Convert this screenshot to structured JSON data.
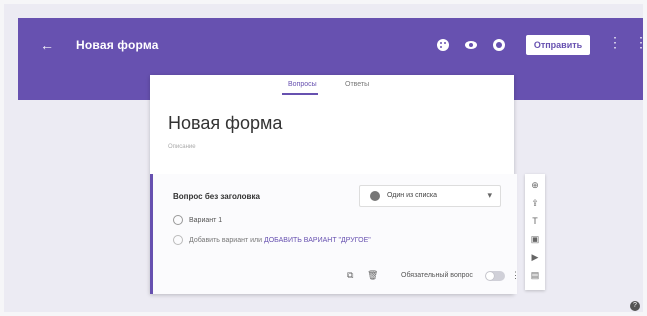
{
  "header": {
    "back_symbol": "←",
    "title": "Новая форма",
    "send_button": "Отправить",
    "kebab": "⋮",
    "more": "⋮"
  },
  "tabs": {
    "questions": "Вопросы",
    "answers": "Ответы"
  },
  "form": {
    "title": "Новая форма",
    "description": "Описание"
  },
  "question": {
    "title": "Вопрос без заголовка",
    "type_label": "Один из списка",
    "option1": "Вариант 1",
    "option2_prefix": "Добавить вариант",
    "option2_or": "или",
    "option2_link": "ДОБАВИТЬ ВАРИАНТ \"ДРУГОЕ\"",
    "required_label": "Обязательный вопрос"
  },
  "colors": {
    "accent": "#6751b0",
    "background": "#ecebf3"
  }
}
